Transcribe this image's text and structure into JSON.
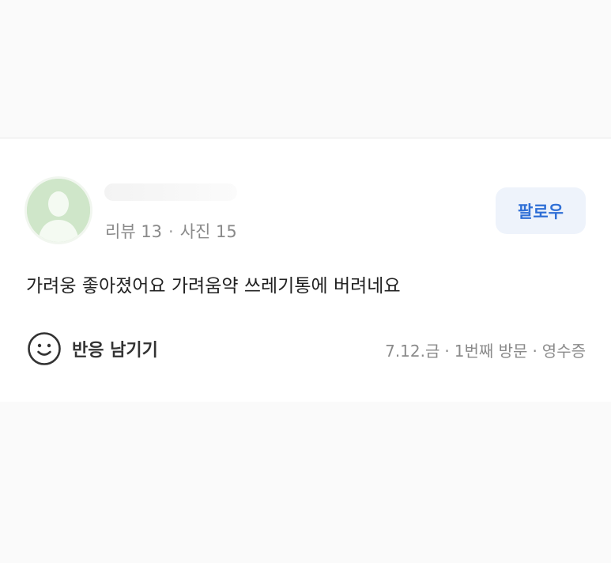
{
  "review": {
    "author_stats": {
      "reviews": "리뷰 13",
      "photos": "사진 15",
      "separator": "·"
    },
    "follow_label": "팔로우",
    "text": "가려웅 좋아졌어요 가려움약 쓰레기통에 버려네요",
    "react_label": "반응 남기기",
    "visit": {
      "date": "7.12.금",
      "visit_count": "1번째 방문",
      "receipt": "영수증",
      "separator": "·"
    }
  },
  "icons": {
    "avatar": "default-user-silhouette-icon",
    "react": "smile-icon"
  },
  "colors": {
    "accent": "#2f6fd6",
    "follow_bg": "#eef3fb",
    "avatar_bg": "#cfe6c9"
  }
}
